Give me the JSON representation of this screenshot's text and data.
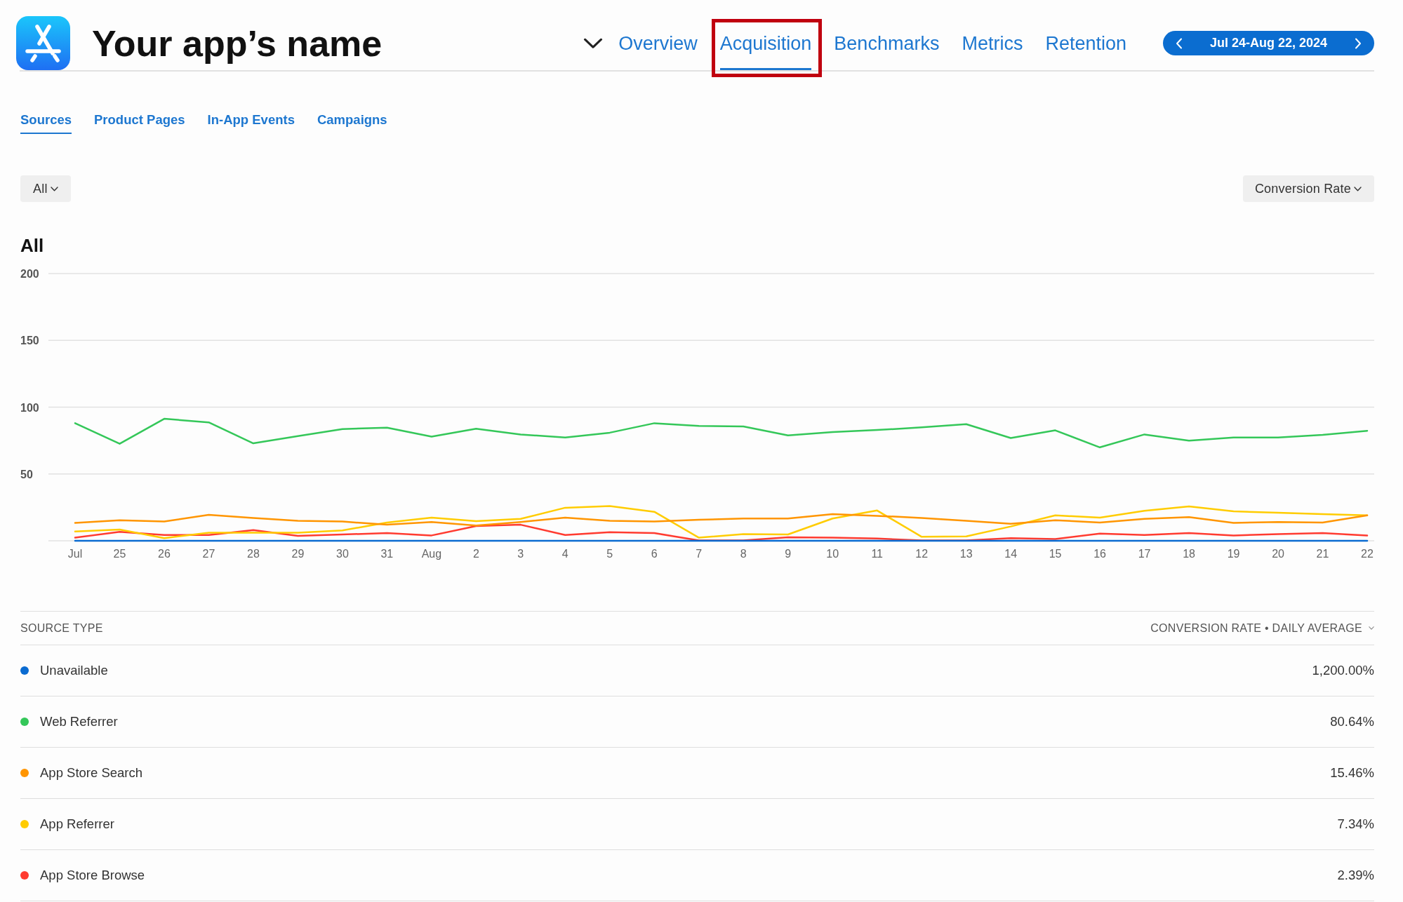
{
  "app": {
    "title": "Your app’s name"
  },
  "nav": {
    "tabs": [
      {
        "label": "Overview",
        "selected": false,
        "highlighted": false
      },
      {
        "label": "Acquisition",
        "selected": true,
        "highlighted": true
      },
      {
        "label": "Benchmarks",
        "selected": false,
        "highlighted": false
      },
      {
        "label": "Metrics",
        "selected": false,
        "highlighted": false
      },
      {
        "label": "Retention",
        "selected": false,
        "highlighted": false
      }
    ],
    "date_range": "Jul 24-Aug 22, 2024"
  },
  "subtabs": [
    {
      "label": "Sources",
      "selected": true
    },
    {
      "label": "Product Pages",
      "selected": false
    },
    {
      "label": "In-App Events",
      "selected": false
    },
    {
      "label": "Campaigns",
      "selected": false
    }
  ],
  "filters": {
    "segment": "All",
    "metric": "Conversion Rate"
  },
  "chart": {
    "chart_data": {
      "type": "line",
      "title": "All",
      "categories": [
        "Jul",
        "25",
        "26",
        "27",
        "28",
        "29",
        "30",
        "31",
        "Aug",
        "2",
        "3",
        "4",
        "5",
        "6",
        "7",
        "8",
        "9",
        "10",
        "11",
        "12",
        "13",
        "14",
        "15",
        "16",
        "17",
        "18",
        "19",
        "20",
        "21",
        "22"
      ],
      "ylim": [
        0,
        200
      ],
      "yticks": [
        50,
        100,
        150,
        200
      ],
      "grid": true,
      "series": [
        {
          "color": "#0a6bd1",
          "values": [
            0,
            0,
            0,
            0,
            0,
            0,
            0,
            0,
            0,
            0,
            0,
            0,
            0,
            0,
            0,
            0,
            0,
            0,
            0,
            0,
            0,
            0,
            0,
            0,
            0,
            0,
            0,
            0,
            0,
            0
          ]
        },
        {
          "color": "#34c759",
          "values": [
            88,
            72.6,
            91.3,
            88.6,
            72.9,
            78.3,
            83.6,
            84.6,
            77.9,
            83.9,
            79.6,
            77.3,
            80.9,
            88,
            86,
            85.6,
            78.9,
            81.3,
            82.9,
            84.9,
            87.3,
            76.9,
            82.6,
            69.9,
            79.6,
            74.9,
            77.3,
            77.3,
            79.3,
            82.3
          ]
        },
        {
          "color": "#ff9500",
          "values": [
            13.4,
            15.4,
            14.4,
            19.4,
            17.1,
            15,
            14.4,
            12,
            14,
            11.4,
            14,
            17.4,
            15,
            14.4,
            15.7,
            16.7,
            16.7,
            20,
            18.7,
            17.1,
            15,
            12.7,
            15.4,
            13.7,
            16.4,
            17.7,
            13.4,
            14,
            13.7,
            19
          ]
        },
        {
          "color": "#ffcc00",
          "values": [
            7,
            8.4,
            2,
            6,
            6,
            6,
            7.7,
            13.7,
            17.4,
            14.7,
            16.4,
            24.7,
            26,
            21.7,
            2.3,
            5,
            4.7,
            16.7,
            22.7,
            3,
            3.3,
            10.7,
            19,
            17.4,
            22.4,
            25.8,
            22,
            21,
            20,
            19
          ]
        },
        {
          "color": "#ff3b30",
          "values": [
            2.3,
            6.7,
            4.3,
            4.3,
            8,
            3.7,
            4.7,
            5.7,
            4,
            11,
            12,
            4.3,
            6.4,
            5.7,
            0.3,
            0.3,
            2.7,
            2.3,
            1.7,
            0.3,
            0.3,
            2,
            1.3,
            5.4,
            4.3,
            5.7,
            4,
            5,
            5.7,
            4
          ]
        }
      ]
    }
  },
  "table": {
    "columns": [
      "SOURCE TYPE",
      "CONVERSION RATE • DAILY AVERAGE"
    ],
    "rows": [
      {
        "name": "Unavailable",
        "value": "1,200.00%",
        "color": "#0a6bd1"
      },
      {
        "name": "Web Referrer",
        "value": "80.64%",
        "color": "#34c759"
      },
      {
        "name": "App Store Search",
        "value": "15.46%",
        "color": "#ff9500"
      },
      {
        "name": "App Referrer",
        "value": "7.34%",
        "color": "#ffcc00"
      },
      {
        "name": "App Store Browse",
        "value": "2.39%",
        "color": "#ff3b30"
      }
    ]
  }
}
